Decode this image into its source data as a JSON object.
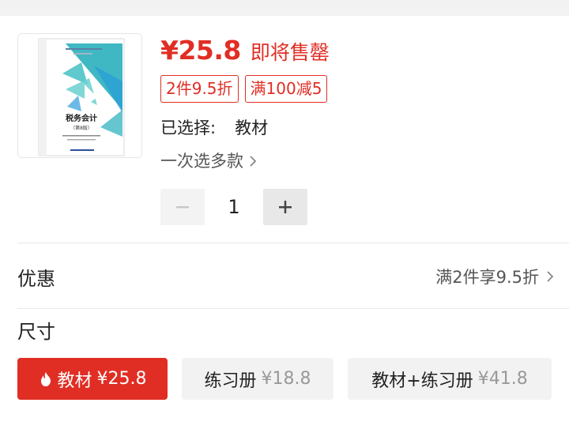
{
  "product": {
    "cover": {
      "title": "税务会计",
      "edition": "（第8版）"
    },
    "price": "¥25.8",
    "stock_status": "即将售罄",
    "tags": [
      "2件9.5折",
      "满100减5"
    ],
    "selected_label": "已选择:",
    "selected_value": "教材",
    "multi_select": "一次选多款",
    "quantity": "1"
  },
  "promo": {
    "label": "优惠",
    "value": "满2件享9.5折"
  },
  "size": {
    "title": "尺寸",
    "options": [
      {
        "name": "教材",
        "price": "¥25.8",
        "active": true
      },
      {
        "name": "练习册",
        "price": "¥18.8",
        "active": false
      },
      {
        "name": "教材+练习册",
        "price": "¥41.8",
        "active": false
      }
    ]
  },
  "colors": {
    "accent": "#e02e24",
    "cover_teal": "#36b6c1",
    "cover_blue": "#5aa0e0"
  }
}
